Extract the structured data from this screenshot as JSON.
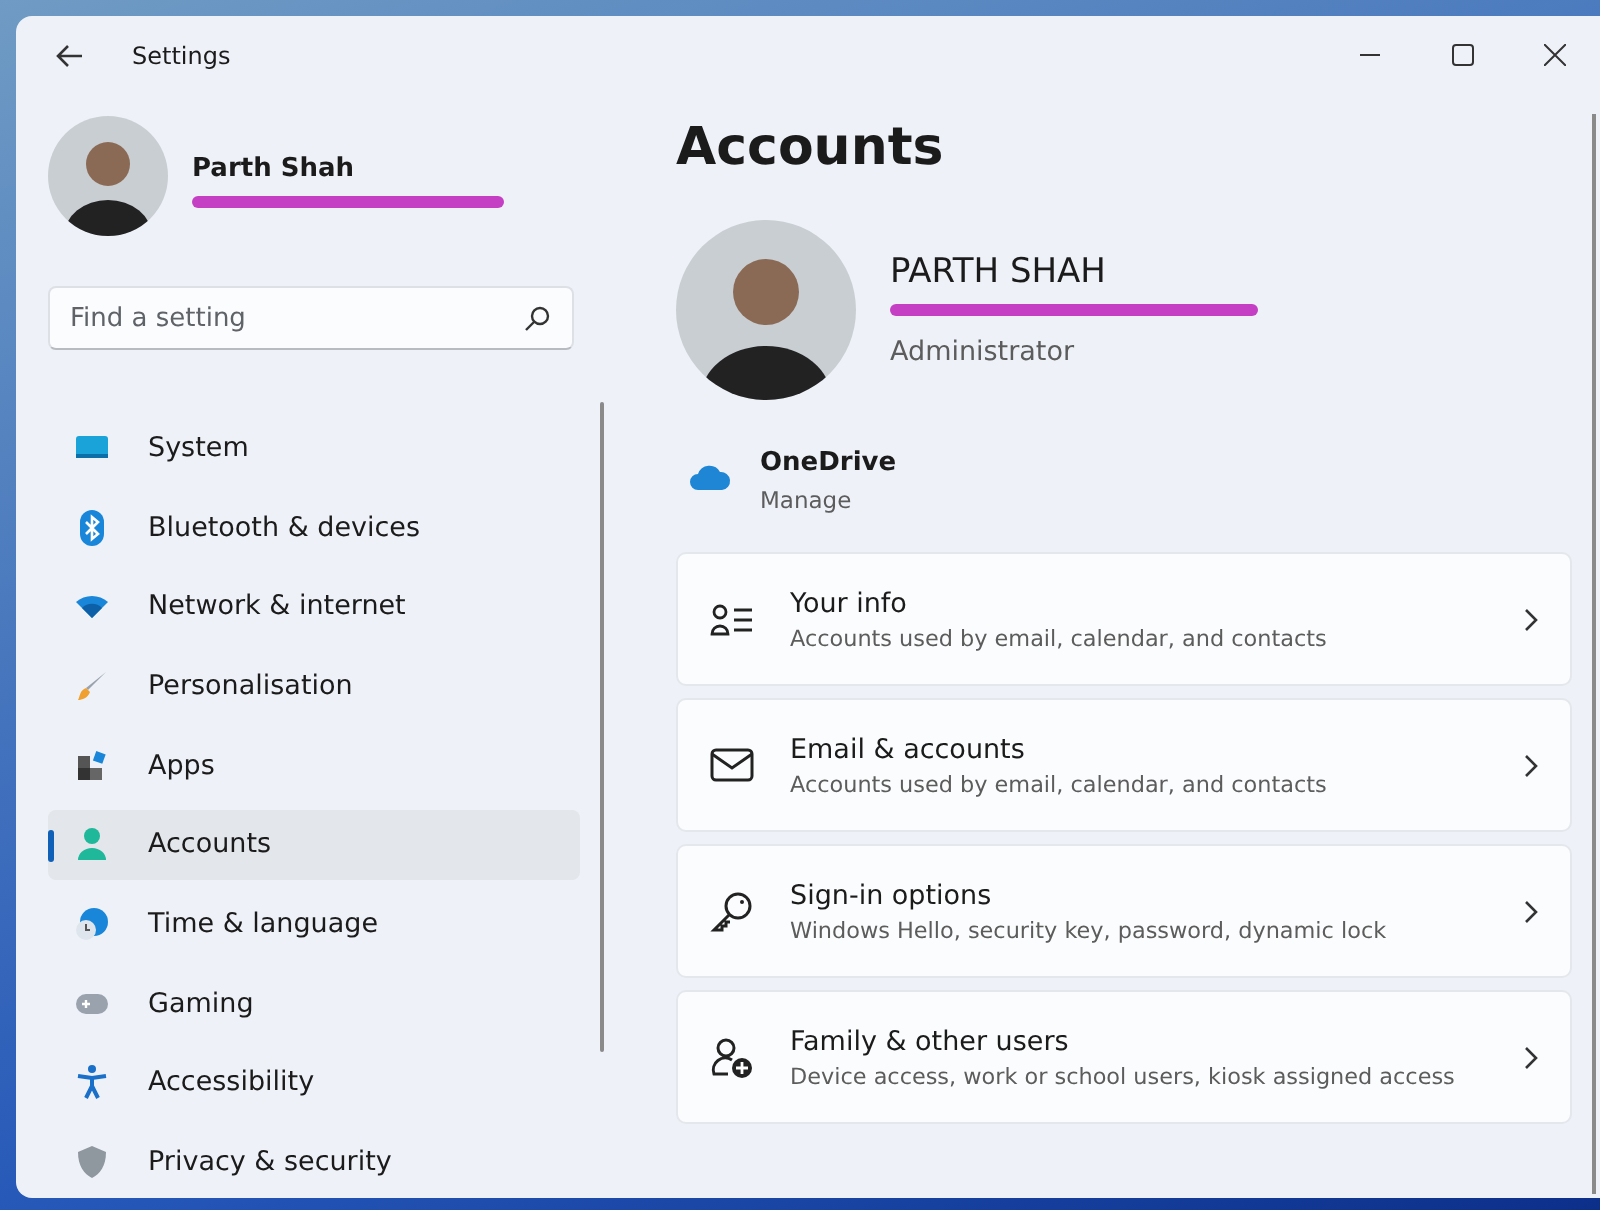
{
  "window": {
    "title": "Settings"
  },
  "sidebar": {
    "profile": {
      "name": "Parth Shah",
      "email_redacted": true
    },
    "search": {
      "placeholder": "Find a setting"
    },
    "items": [
      {
        "label": "System",
        "selected": false
      },
      {
        "label": "Bluetooth & devices",
        "selected": false
      },
      {
        "label": "Network & internet",
        "selected": false
      },
      {
        "label": "Personalisation",
        "selected": false
      },
      {
        "label": "Apps",
        "selected": false
      },
      {
        "label": "Accounts",
        "selected": true
      },
      {
        "label": "Time & language",
        "selected": false
      },
      {
        "label": "Gaming",
        "selected": false
      },
      {
        "label": "Accessibility",
        "selected": false
      },
      {
        "label": "Privacy & security",
        "selected": false
      }
    ]
  },
  "page": {
    "title": "Accounts",
    "account": {
      "name": "PARTH SHAH",
      "email_redacted": true,
      "role": "Administrator"
    },
    "onedrive": {
      "title": "OneDrive",
      "action": "Manage"
    },
    "cards": [
      {
        "title": "Your info",
        "subtitle": "Accounts used by email, calendar, and contacts"
      },
      {
        "title": "Email & accounts",
        "subtitle": "Accounts used by email, calendar, and contacts"
      },
      {
        "title": "Sign-in options",
        "subtitle": "Windows Hello, security key, password, dynamic lock"
      },
      {
        "title": "Family & other users",
        "subtitle": "Device access, work or school users, kiosk assigned access"
      }
    ]
  }
}
